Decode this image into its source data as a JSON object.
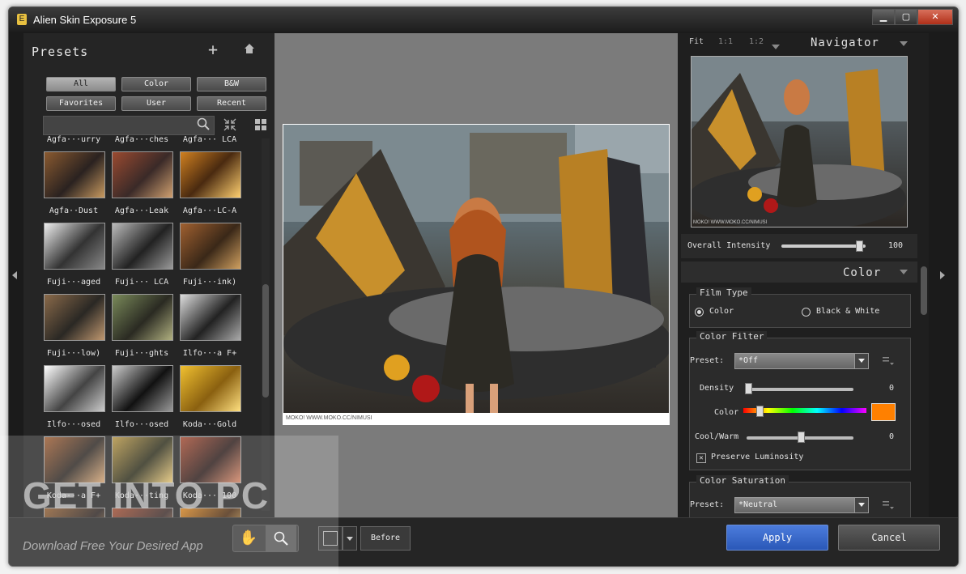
{
  "window": {
    "title": "Alien Skin Exposure 5",
    "min": "▁",
    "max": "▢",
    "close": "✕"
  },
  "presets": {
    "title": "Presets",
    "filters": [
      "All",
      "Color",
      "B&W",
      "Favorites",
      "User",
      "Recent"
    ],
    "active_filter": "All",
    "search_placeholder": "",
    "items": [
      {
        "label": "Agfa···urry"
      },
      {
        "label": "Agfa···ches"
      },
      {
        "label": "Agfa··· LCA"
      },
      {
        "label": "Agfa··Dust"
      },
      {
        "label": "Agfa···Leak"
      },
      {
        "label": "Agfa···LC-A"
      },
      {
        "label": "Fuji···aged"
      },
      {
        "label": "Fuji··· LCA"
      },
      {
        "label": "Fuji···ink)"
      },
      {
        "label": "Fuji···low)"
      },
      {
        "label": "Fuji···ghts"
      },
      {
        "label": "Ilfo···a F+"
      },
      {
        "label": "Ilfo···osed"
      },
      {
        "label": "Ilfo···osed"
      },
      {
        "label": "Koda···Gold"
      },
      {
        "label": "Koda···a F+"
      },
      {
        "label": "Koda···ting"
      },
      {
        "label": "Koda··· 100"
      }
    ]
  },
  "canvas": {
    "caption": "MOKO! WWW.MOKO.CC/NIMUSI"
  },
  "navigator": {
    "zoom_tabs": [
      "Fit",
      "1:1",
      "1:2"
    ],
    "title": "Navigator",
    "caption": "MOKO! WWW.MOKO.CC/NIMUSI",
    "overall_intensity_label": "Overall Intensity",
    "overall_intensity_value": "100"
  },
  "color_section": {
    "title": "Color",
    "film_type": {
      "title": "Film Type",
      "option_color": "Color",
      "option_bw": "Black & White",
      "selected": "Color"
    },
    "color_filter": {
      "title": "Color Filter",
      "preset_label": "Preset:",
      "preset_value": "*Off",
      "density_label": "Density",
      "density_value": "0",
      "color_label": "Color",
      "swatch_color": "#ff8000",
      "coolwarm_label": "Cool/Warm",
      "coolwarm_value": "0",
      "preserve_label": "Preserve Luminosity",
      "preserve_checked": true
    },
    "color_saturation": {
      "title": "Color Saturation",
      "preset_label": "Preset:",
      "preset_value": "*Neutral"
    }
  },
  "bottom": {
    "before_label": "Before",
    "apply_label": "Apply",
    "cancel_label": "Cancel"
  },
  "watermark": {
    "text": "GET INTO PC",
    "subtext": "Download Free Your Desired App"
  },
  "colors": {
    "apply": "#2f62c4",
    "swatch": "#ff8000"
  }
}
